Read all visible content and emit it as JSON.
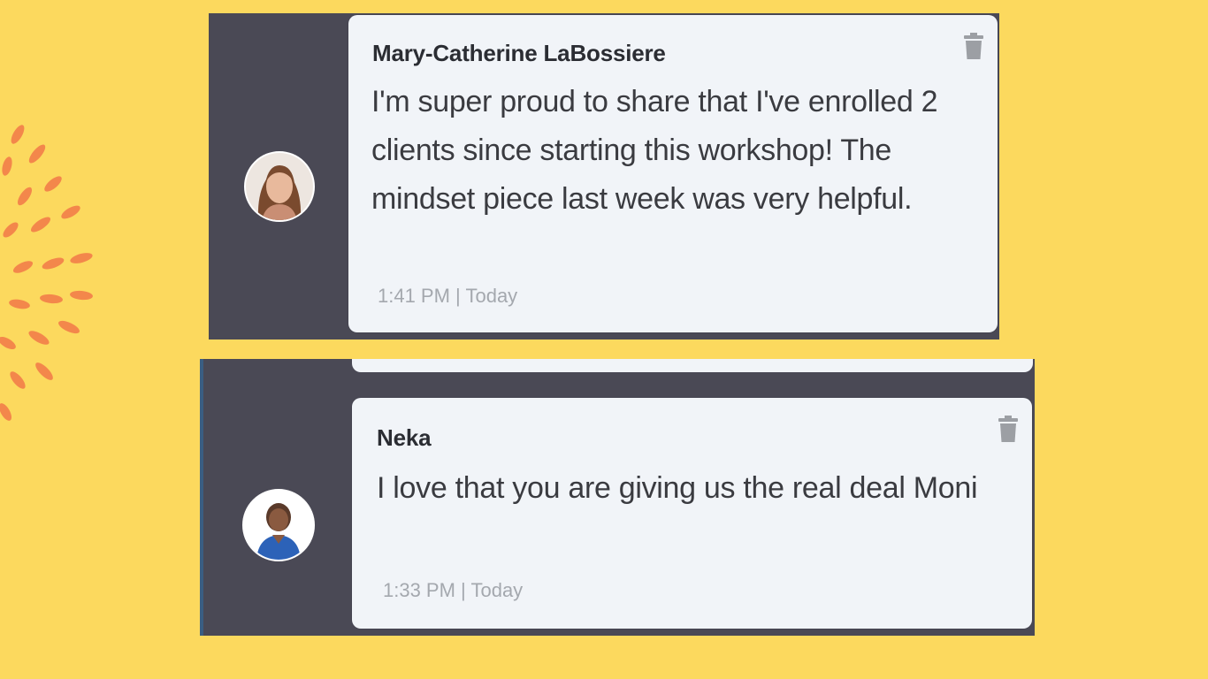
{
  "messages": [
    {
      "author": "Mary-Catherine LaBossiere",
      "text": "I'm super proud to share that I've enrolled 2 clients since starting this workshop! The mindset piece last week was very helpful.",
      "timestamp": "1:41 PM | Today",
      "avatar_icon": "user-avatar-photo"
    },
    {
      "author": "Neka",
      "text": "I love that you are giving us the real deal Moni",
      "timestamp": "1:33 PM | Today",
      "avatar_icon": "user-avatar-photo"
    }
  ],
  "icons": {
    "delete": "trash-icon",
    "decoration": "sunburst-decoration"
  },
  "colors": {
    "background": "#FCD95E",
    "panel": "#4A4955",
    "card": "#F1F4F8",
    "accent_decoration": "#F3874B"
  }
}
